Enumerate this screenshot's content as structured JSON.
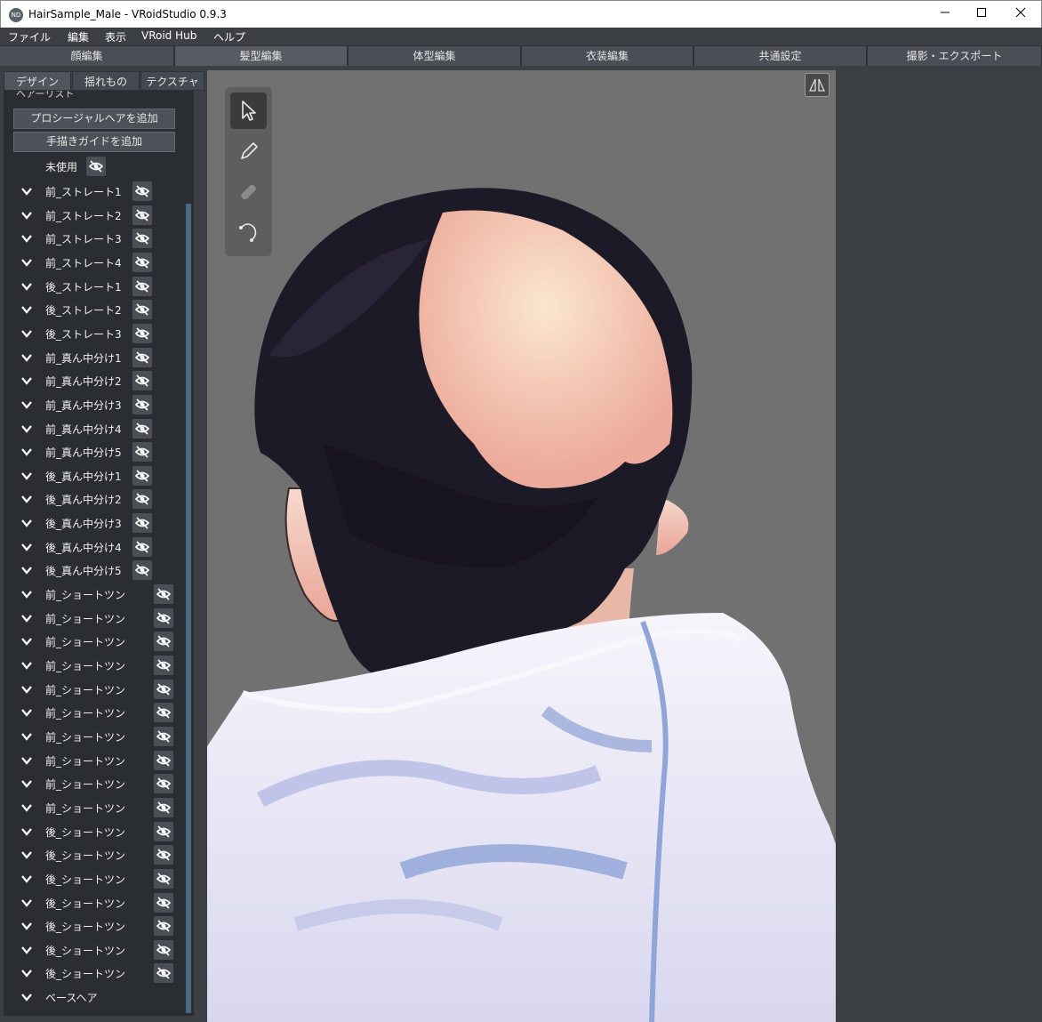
{
  "window": {
    "title": "HairSample_Male - VRoidStudio 0.9.3",
    "app_icon_label": "ND"
  },
  "menu": [
    "ファイル",
    "編集",
    "表示",
    "VRoid Hub",
    "ヘルプ"
  ],
  "main_tabs": [
    "顔編集",
    "髪型編集",
    "体型編集",
    "衣装編集",
    "共通設定",
    "撮影・エクスポート"
  ],
  "active_main_tab": "髪型編集",
  "sub_tabs": [
    "デザイン",
    "揺れもの",
    "テクスチャ"
  ],
  "active_sub_tab": "デザイン",
  "hair_list": {
    "heading": "ヘアーリスト",
    "add_procedural_label": "プロシージャルヘアを追加",
    "add_guide_label": "手描きガイドを追加",
    "unused_label": "未使用",
    "items": [
      "前_ストレート1",
      "前_ストレート2",
      "前_ストレート3",
      "前_ストレート4",
      "後_ストレート1",
      "後_ストレート2",
      "後_ストレート3",
      "前_真ん中分け1",
      "前_真ん中分け2",
      "前_真ん中分け3",
      "前_真ん中分け4",
      "前_真ん中分け5",
      "後_真ん中分け1",
      "後_真ん中分け2",
      "後_真ん中分け3",
      "後_真ん中分け4",
      "後_真ん中分け5",
      "前_ショートツン",
      "前_ショートツン",
      "前_ショートツン",
      "前_ショートツン",
      "前_ショートツン",
      "前_ショートツン",
      "前_ショートツン",
      "前_ショートツン",
      "前_ショートツン",
      "前_ショートツン",
      "後_ショートツン",
      "後_ショートツン",
      "後_ショートツン",
      "後_ショートツン",
      "後_ショートツン",
      "後_ショートツン",
      "後_ショートツン"
    ],
    "base_hair_label": "ベースヘア"
  },
  "tools": [
    "select-tool",
    "pen-tool",
    "eraser-tool",
    "smooth-tool"
  ],
  "colors": {
    "background": "#3c4044",
    "viewport": "#717171",
    "hair": "#1c1826",
    "skin": "#f0b9a6",
    "hoodie": "#e8e8f6",
    "accent": "#466a82"
  }
}
